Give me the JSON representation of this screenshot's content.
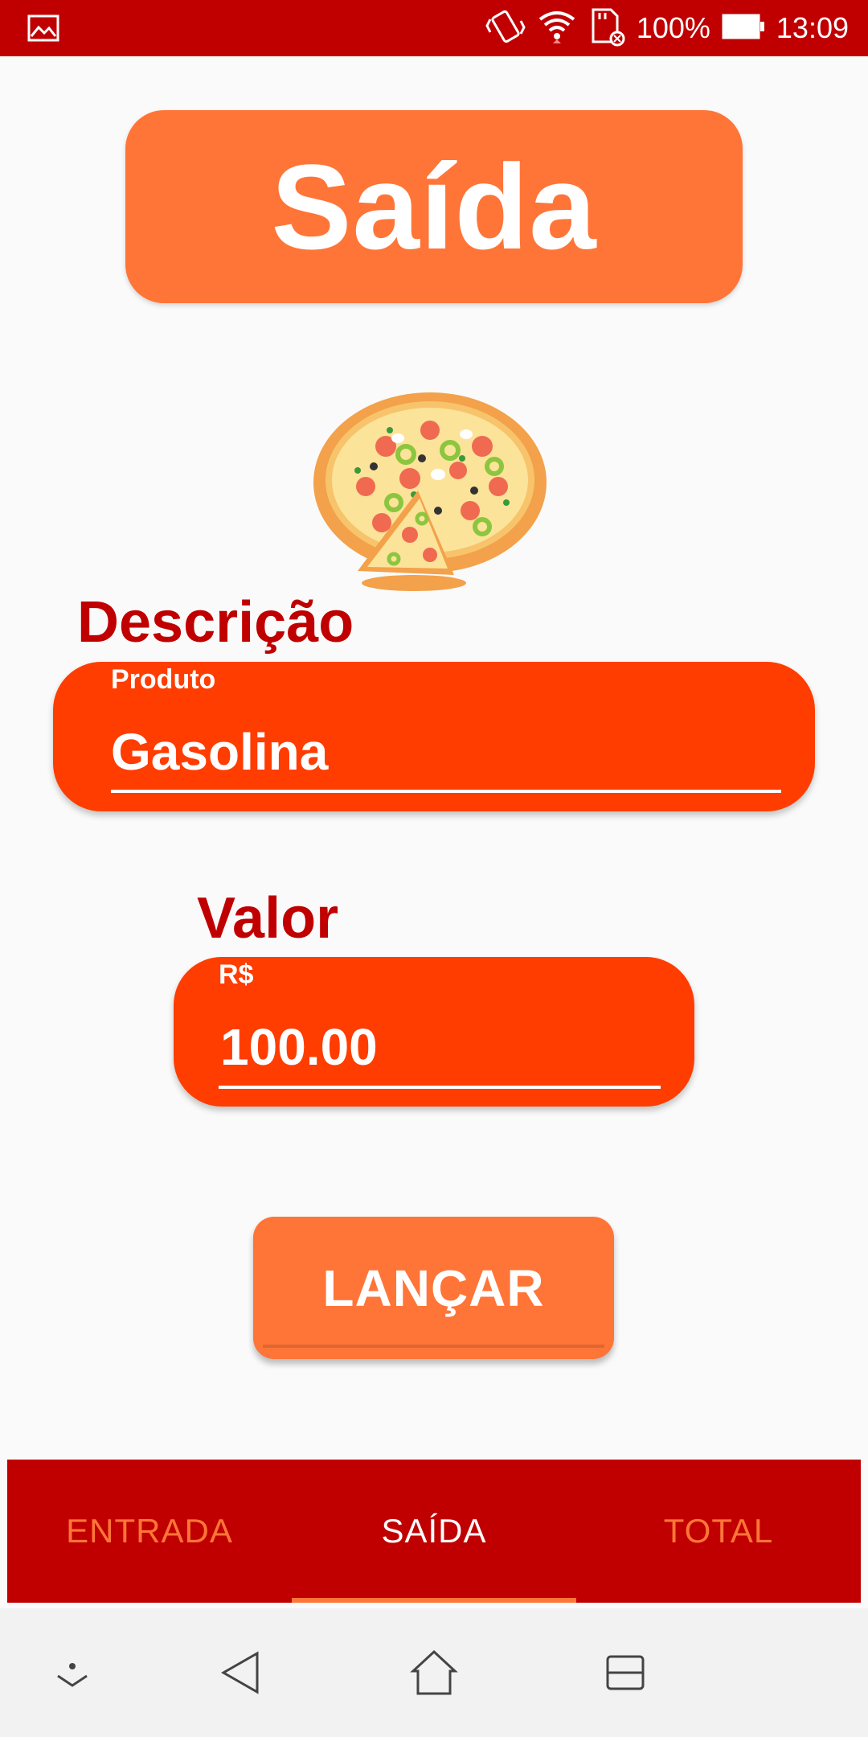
{
  "status_bar": {
    "battery": "100%",
    "time": "13:09",
    "icons": [
      "gallery-icon",
      "vibrate-icon",
      "wifi-icon",
      "sd-card-icon",
      "battery-icon"
    ]
  },
  "header": {
    "title": "Saída"
  },
  "description": {
    "label": "Descrição",
    "hint": "Produto",
    "value": "Gasolina"
  },
  "amount": {
    "label": "Valor",
    "hint": "R$",
    "value": "100.00"
  },
  "actions": {
    "launch_label": "LANÇAR"
  },
  "tabs": [
    {
      "label": "ENTRADA",
      "active": false
    },
    {
      "label": "SAÍDA",
      "active": true
    },
    {
      "label": "TOTAL",
      "active": false
    }
  ],
  "nav_bar": {
    "icons": [
      "collapse-icon",
      "back-icon",
      "home-icon",
      "recents-icon"
    ]
  },
  "colors": {
    "primary_red": "#c00000",
    "accent_orange": "#ff7538",
    "field_orange": "#ff3d00",
    "background": "#fafafa"
  }
}
